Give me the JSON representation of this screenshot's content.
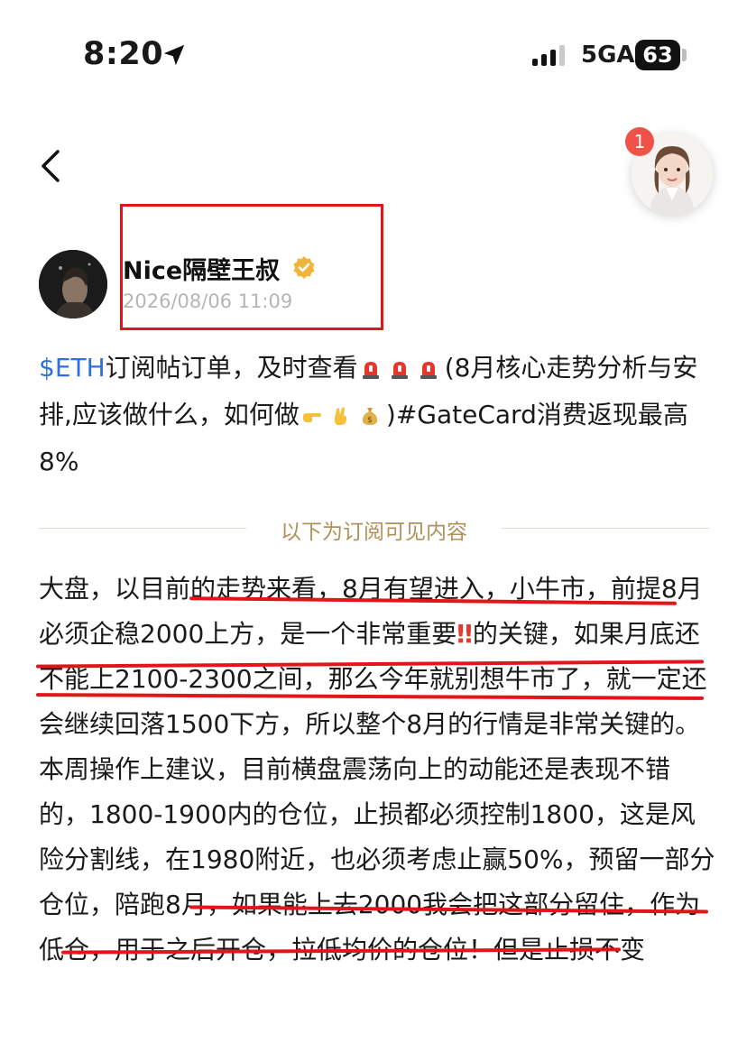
{
  "status_bar": {
    "time": "8:20",
    "network": "5GA",
    "battery": "63"
  },
  "header": {
    "notification_count": "1"
  },
  "author": {
    "name": "Nice隔壁王叔",
    "timestamp": "2026/08/06 11:09"
  },
  "post": {
    "ticker": "$ETH",
    "title_part1": "订阅帖订单，及时查看",
    "title_part2": "(8月核心走势分析与安排,应该做什么，如何做",
    "title_part3": ")#GateCard消费返现最高8%",
    "divider_label": "以下为订阅可见内容",
    "p1_a": "大盘，以目前的走势来看，8月有望进入，小牛市，前提8月必须企稳2000上方，是一个非常重要",
    "p1_b": "的关键，如果月底还不能上2100-2300之间，那么今年就别想牛市了，就一定还会继续回落1500下方，所以整个8月的行情是非常关键的。",
    "p2": "本周操作上建议，目前横盘震荡向上的动能还是表现不错的，1800-1900内的仓位，止损都必须控制1800，这是风险分割线，在1980附近，也必须考虑止赢50%，预留一部分仓位，陪跑8月，如果能上去2000我会把这部分留住，作为低仓，用于之后开仓，拉低均价的仓位！但是止损不变"
  },
  "colors": {
    "accent_red": "#e4141b",
    "ticker_blue": "#2f6fde",
    "divider_gold": "#b0915a",
    "timestamp_gray": "#b5b5b5"
  },
  "icons": [
    "location-arrow-icon",
    "signal-icon",
    "battery-icon",
    "back-chevron-icon",
    "verified-badge-icon",
    "siren-emoji-icon",
    "pointing-hand-emoji-icon",
    "crossed-fingers-emoji-icon",
    "money-bag-emoji-icon",
    "double-exclamation-icon"
  ]
}
